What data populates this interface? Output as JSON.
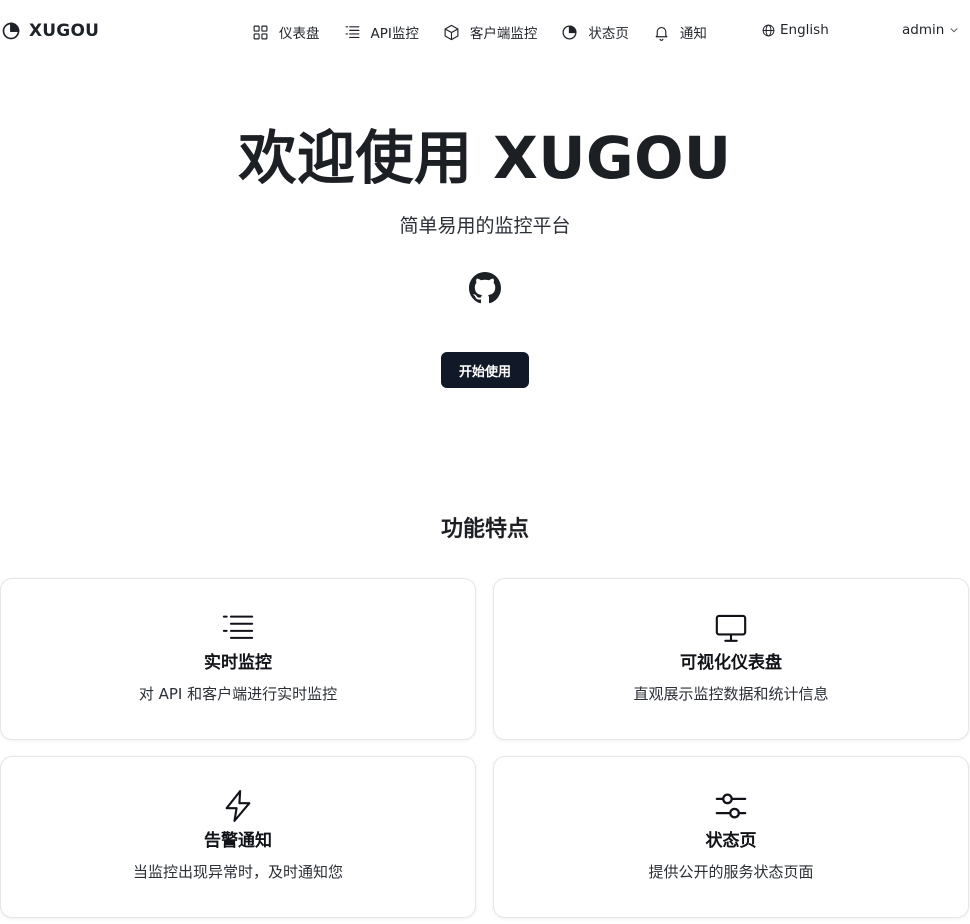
{
  "header": {
    "brand": "XUGOU",
    "nav": [
      {
        "label": "仪表盘",
        "icon": "grid-icon"
      },
      {
        "label": "API监控",
        "icon": "list-icon"
      },
      {
        "label": "客户端监控",
        "icon": "box-icon"
      },
      {
        "label": "状态页",
        "icon": "pie-icon"
      },
      {
        "label": "通知",
        "icon": "bell-icon"
      }
    ],
    "language": "English",
    "user": "admin"
  },
  "hero": {
    "title": "欢迎使用 XUGOU",
    "subtitle": "简单易用的监控平台",
    "start_button": "开始使用"
  },
  "features": {
    "title": "功能特点",
    "cards": [
      {
        "title": "实时监控",
        "desc": "对 API 和客户端进行实时监控",
        "icon": "list-icon"
      },
      {
        "title": "可视化仪表盘",
        "desc": "直观展示监控数据和统计信息",
        "icon": "monitor-icon"
      },
      {
        "title": "告警通知",
        "desc": "当监控出现异常时，及时通知您",
        "icon": "lightning-icon"
      },
      {
        "title": "状态页",
        "desc": "提供公开的服务状态页面",
        "icon": "sliders-icon"
      }
    ]
  }
}
